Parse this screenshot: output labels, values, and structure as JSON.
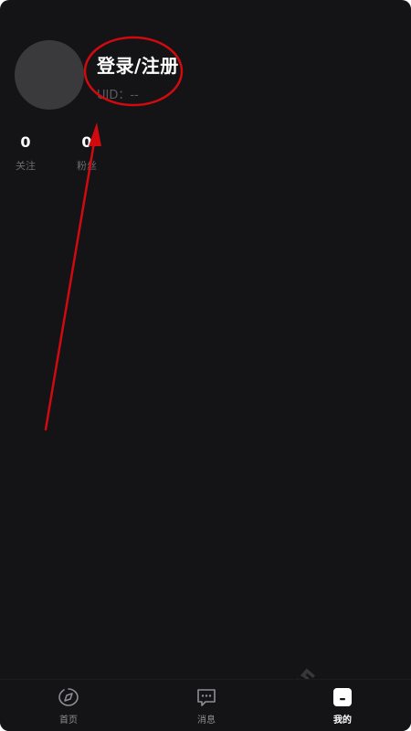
{
  "profile": {
    "login_label": "登录/注册",
    "uid_text": "UID：--"
  },
  "stats": [
    {
      "value": "0",
      "label": "关注"
    },
    {
      "value": "0",
      "label": "粉丝"
    }
  ],
  "tabbar": {
    "items": [
      {
        "label": "首页",
        "icon": "home-compass-icon",
        "active": false
      },
      {
        "label": "消息",
        "icon": "message-icon",
        "active": false
      },
      {
        "label": "我的",
        "icon": "profile-icon",
        "active": true
      }
    ]
  },
  "watermark": "54下载站",
  "colors": {
    "background": "#141416",
    "avatar": "#3a3a3c",
    "annotation_red": "#d10a10",
    "active_tab": "#ffffff",
    "inactive_tab": "#8e8e93"
  }
}
